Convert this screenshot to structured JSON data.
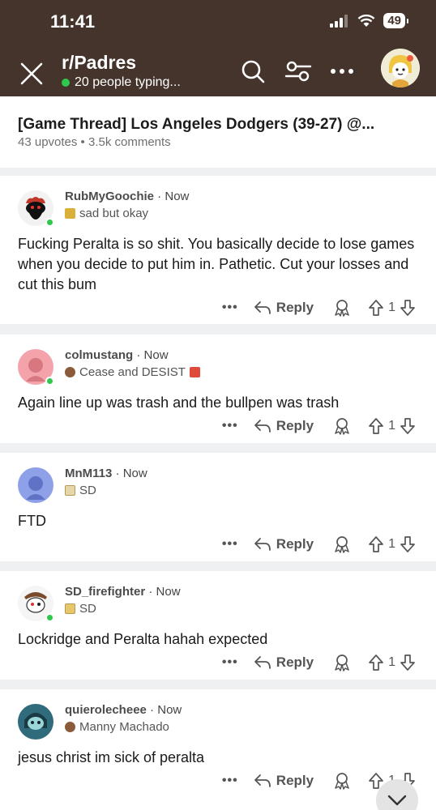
{
  "status_bar": {
    "time": "11:41",
    "battery": "49"
  },
  "header": {
    "subreddit": "r/Padres",
    "typing_text": "20 people typing..."
  },
  "post": {
    "title": "[Game Thread] Los Angeles Dodgers (39-27) @...",
    "meta": "43 upvotes • 3.5k comments"
  },
  "comments": [
    {
      "username": "RubMyGoochie",
      "time": "Now",
      "flair": "sad but okay",
      "body": "Fucking Peralta is so shit. You basically decide to lose games when you decide to put him in. Pathetic. Cut your losses and cut this bum",
      "reply_label": "Reply",
      "votes": "1"
    },
    {
      "username": "colmustang",
      "time": "Now",
      "flair": "Cease and DESIST",
      "body": "Again line up was trash and the bullpen was trash",
      "reply_label": "Reply",
      "votes": "1"
    },
    {
      "username": "MnM113",
      "time": "Now",
      "flair": "SD",
      "body": "FTD",
      "reply_label": "Reply",
      "votes": "1"
    },
    {
      "username": "SD_firefighter",
      "time": "Now",
      "flair": "SD",
      "body": "Lockridge and Peralta hahah expected",
      "reply_label": "Reply",
      "votes": "1"
    },
    {
      "username": "quierolecheee",
      "time": "Now",
      "flair": "Manny Machado",
      "body": "jesus christ im sick of peralta",
      "reply_label": "Reply",
      "votes": "1"
    }
  ],
  "colors": {
    "header_bg": "#44342b",
    "online": "#2dc84d"
  },
  "icons": [
    "close-icon",
    "search-icon",
    "filter-icon",
    "more-icon",
    "reply-icon",
    "award-icon",
    "upvote-icon",
    "downvote-icon",
    "scroll-down-icon"
  ]
}
